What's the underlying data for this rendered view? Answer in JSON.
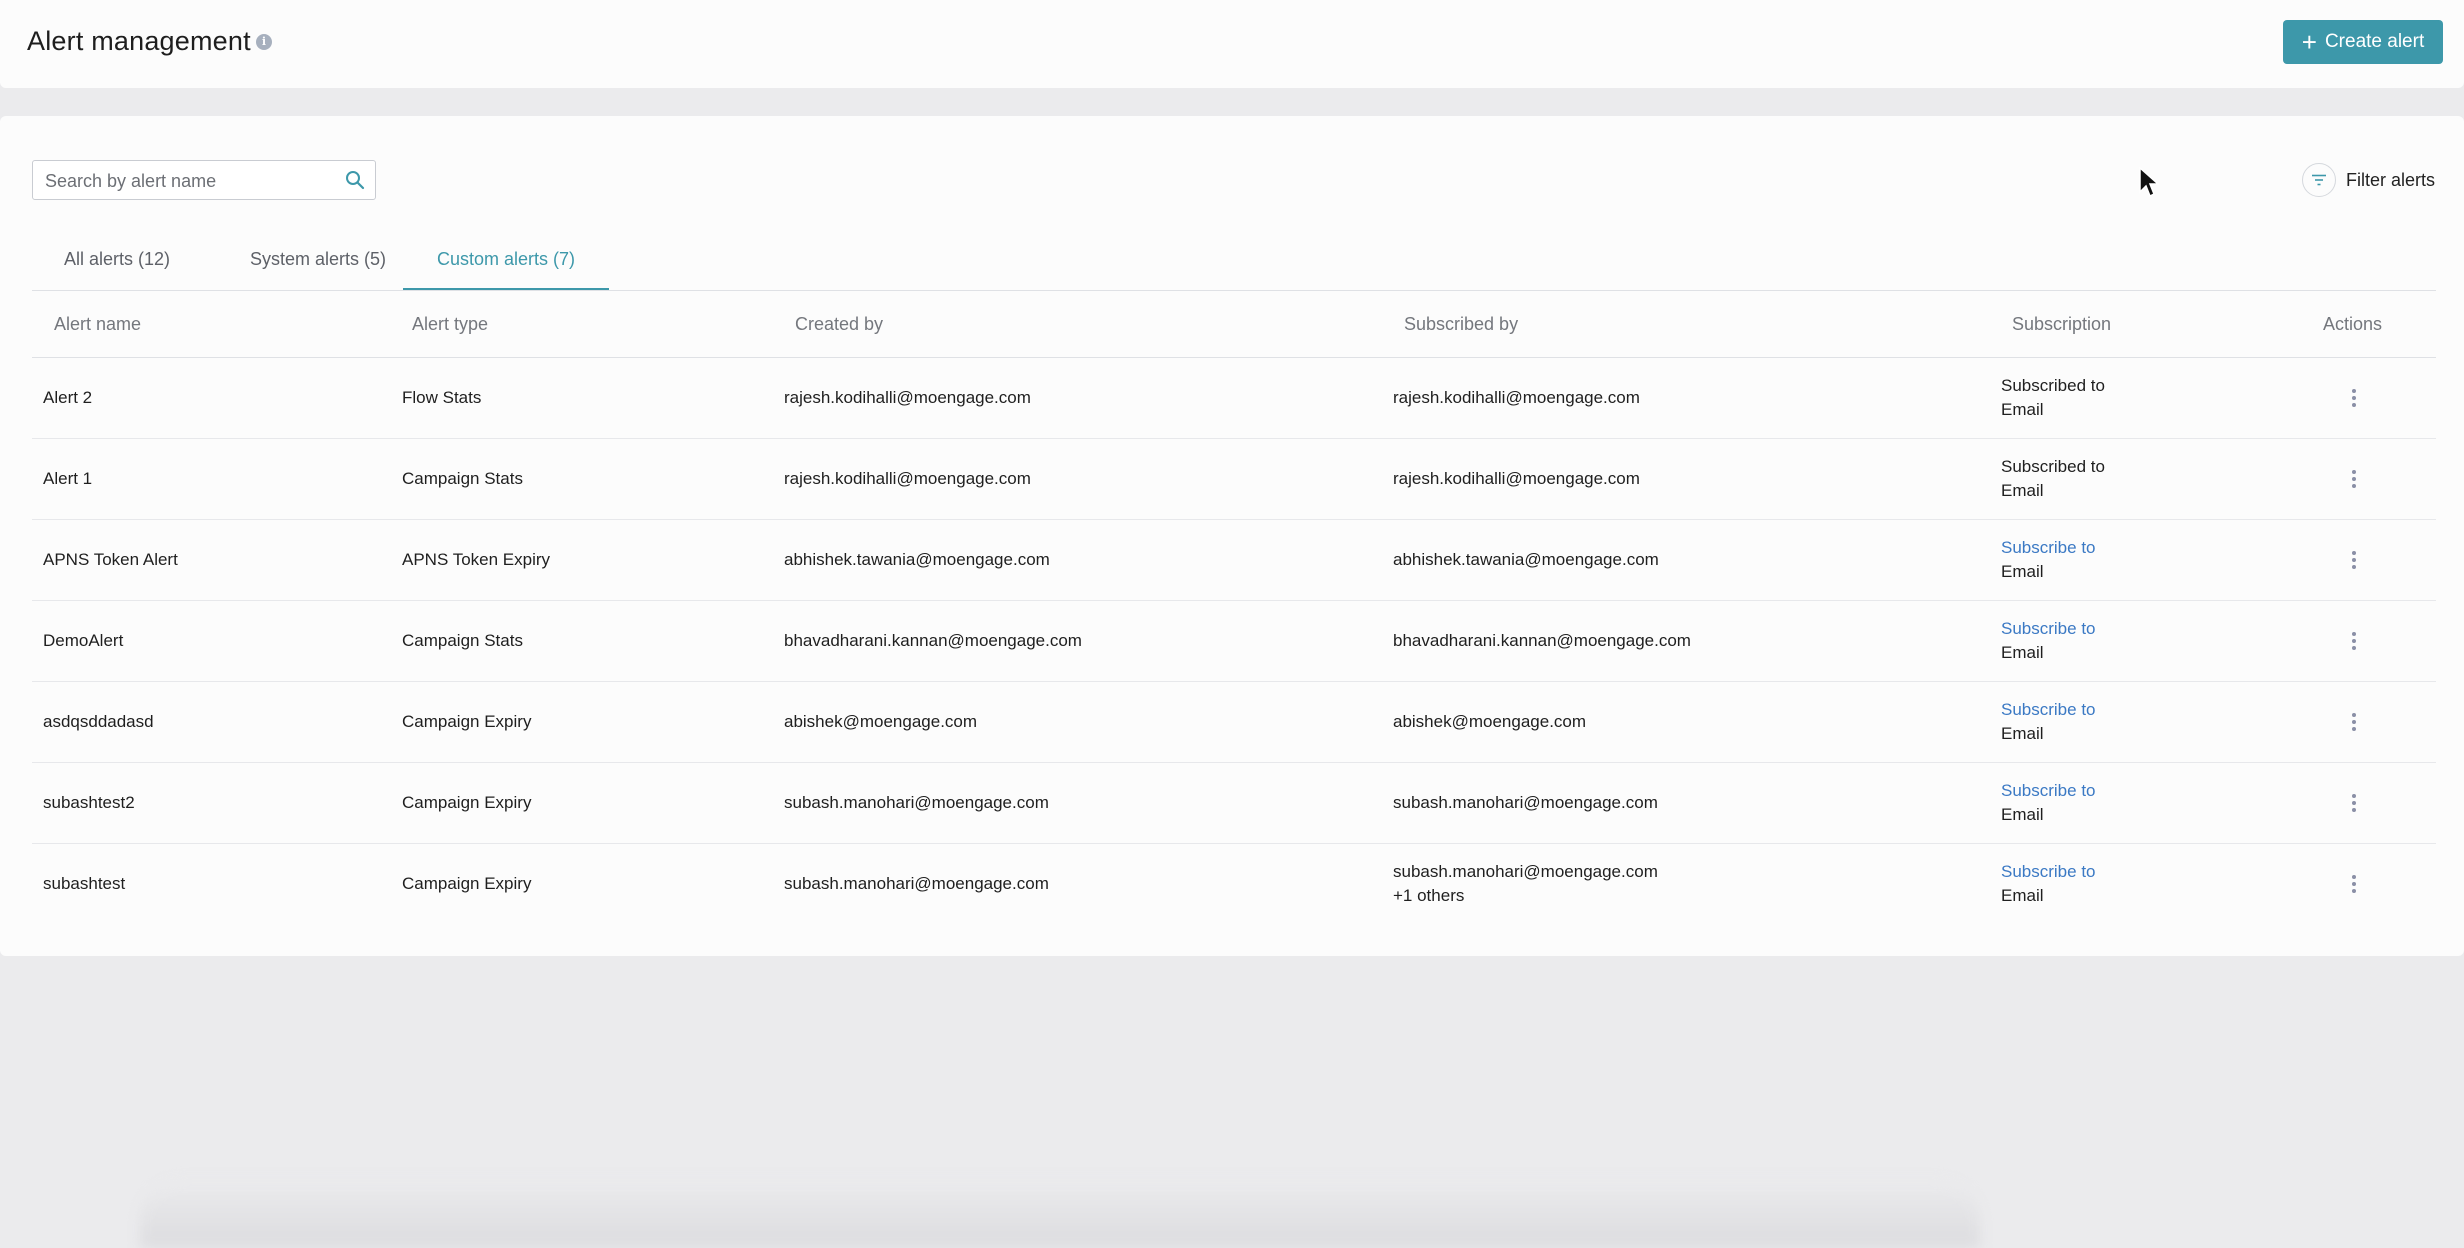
{
  "header": {
    "title": "Alert management",
    "info_icon": "info-icon",
    "create_button": "Create alert"
  },
  "search": {
    "placeholder": "Search by alert name",
    "value": ""
  },
  "filter": {
    "label": "Filter alerts"
  },
  "tabs": [
    {
      "label": "All alerts (12)",
      "active": false
    },
    {
      "label": "System alerts (5)",
      "active": false
    },
    {
      "label": "Custom alerts (7)",
      "active": true
    }
  ],
  "table": {
    "headers": [
      "Alert name",
      "Alert type",
      "Created by",
      "Subscribed by",
      "Subscription",
      "Actions"
    ],
    "rows": [
      {
        "name": "Alert 2",
        "type": "Flow Stats",
        "created_by": "rajesh.kodihalli@moengage.com",
        "subscribed_by": "rajesh.kodihalli@moengage.com",
        "subscribed_by_extra": "",
        "subscription_line1": "Subscribed to",
        "subscription_line2": "Email",
        "subscribed": true
      },
      {
        "name": "Alert 1",
        "type": "Campaign Stats",
        "created_by": "rajesh.kodihalli@moengage.com",
        "subscribed_by": "rajesh.kodihalli@moengage.com",
        "subscribed_by_extra": "",
        "subscription_line1": "Subscribed to",
        "subscription_line2": "Email",
        "subscribed": true
      },
      {
        "name": "APNS Token Alert",
        "type": "APNS Token Expiry",
        "created_by": "abhishek.tawania@moengage.com",
        "subscribed_by": "abhishek.tawania@moengage.com",
        "subscribed_by_extra": "",
        "subscription_line1": "Subscribe to",
        "subscription_line2": "Email",
        "subscribed": false
      },
      {
        "name": "DemoAlert",
        "type": "Campaign Stats",
        "created_by": "bhavadharani.kannan@moengage.com",
        "subscribed_by": "bhavadharani.kannan@moengage.com",
        "subscribed_by_extra": "",
        "subscription_line1": "Subscribe to",
        "subscription_line2": "Email",
        "subscribed": false
      },
      {
        "name": "asdqsddadasd",
        "type": "Campaign Expiry",
        "created_by": "abishek@moengage.com",
        "subscribed_by": "abishek@moengage.com",
        "subscribed_by_extra": "",
        "subscription_line1": "Subscribe to",
        "subscription_line2": "Email",
        "subscribed": false
      },
      {
        "name": "subashtest2",
        "type": "Campaign Expiry",
        "created_by": "subash.manohari@moengage.com",
        "subscribed_by": "subash.manohari@moengage.com",
        "subscribed_by_extra": "",
        "subscription_line1": "Subscribe to",
        "subscription_line2": "Email",
        "subscribed": false
      },
      {
        "name": "subashtest",
        "type": "Campaign Expiry",
        "created_by": "subash.manohari@moengage.com",
        "subscribed_by": "subash.manohari@moengage.com",
        "subscribed_by_extra": "+1 others",
        "subscription_line1": "Subscribe to",
        "subscription_line2": "Email",
        "subscribed": false
      }
    ]
  },
  "colors": {
    "accent": "#3d98aa",
    "link": "#3b79c4",
    "background": "#ebebed",
    "panel": "#fcfcfc"
  },
  "icons": {
    "search": "search-icon",
    "filter": "filter-icon",
    "actions": "more-vertical-icon",
    "create": "plus-icon"
  }
}
